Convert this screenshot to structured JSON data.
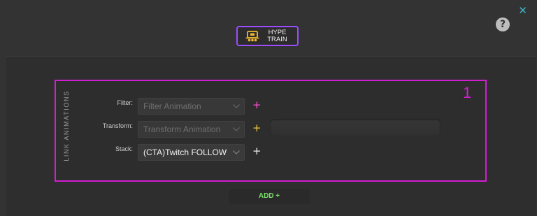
{
  "window": {
    "close_glyph": "✕",
    "help_glyph": "?"
  },
  "event": {
    "icon": "train-icon",
    "line1": "HYPE",
    "line2": "TRAIN",
    "accent_color": "#9b4dff"
  },
  "group": {
    "number": "1",
    "vertical_label": "LINK ANIMATIONS",
    "border_color": "#d11ed1"
  },
  "rows": {
    "filter": {
      "label": "Filter:",
      "placeholder": "Filter Animation",
      "plus": "+",
      "plus_color": "#ff4fd2"
    },
    "transform": {
      "label": "Transform:",
      "placeholder": "Transform Animation",
      "plus": "+",
      "plus_color": "#f3c93a"
    },
    "stack": {
      "label": "Stack:",
      "value": "(CTA)Twitch FOLLOW",
      "plus": "+",
      "plus_color": "#f0f0f0"
    }
  },
  "add_button": {
    "label": "ADD +",
    "color": "#7be06a"
  }
}
